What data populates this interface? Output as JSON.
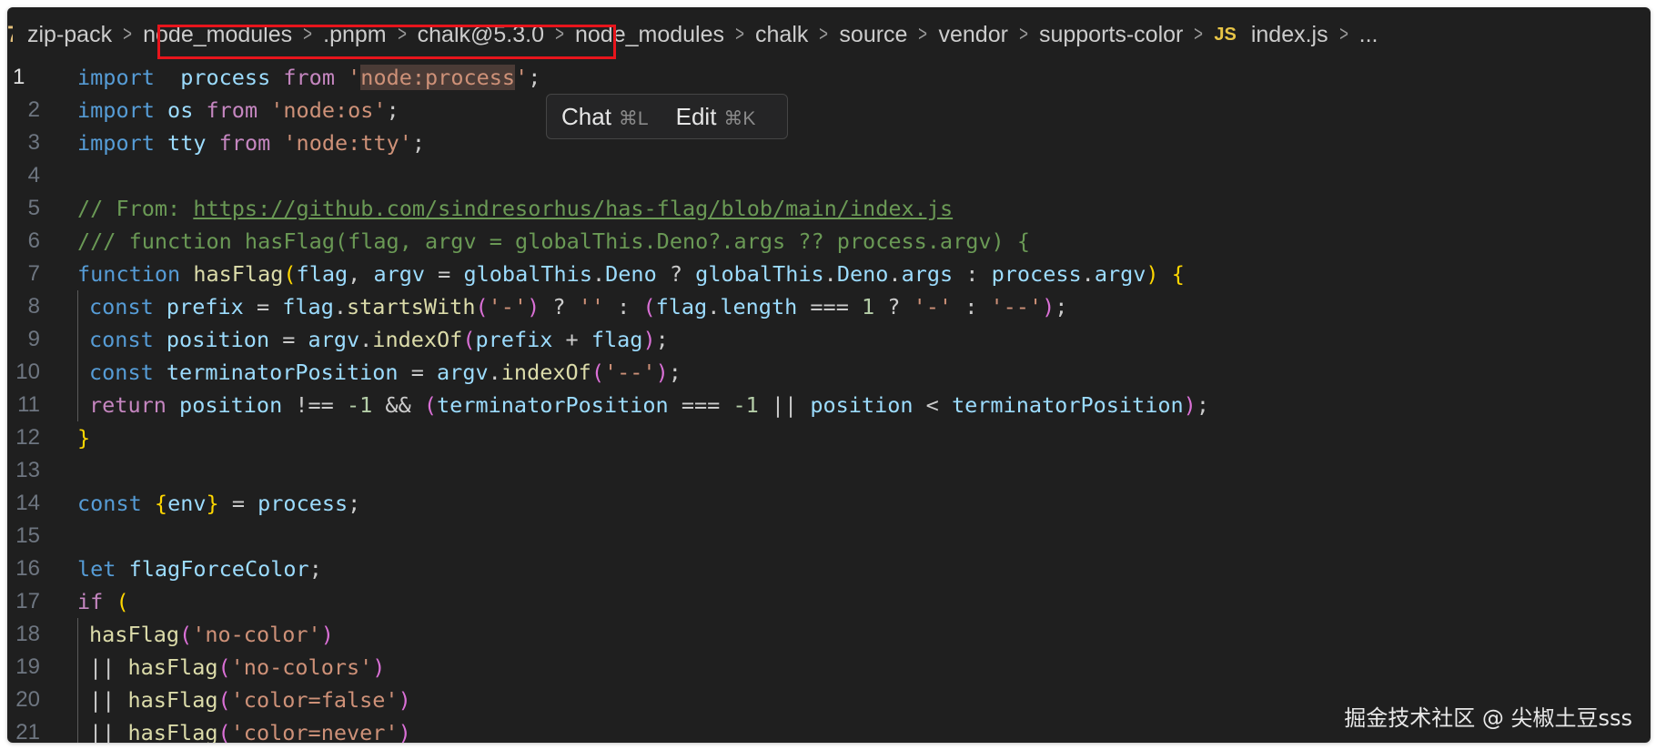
{
  "breadcrumb": {
    "items": [
      "zip-pack",
      "node_modules",
      ".pnpm",
      "chalk@5.3.0",
      "node_modules",
      "chalk",
      "source",
      "vendor",
      "supports-color"
    ],
    "file_icon": "JS",
    "file": "index.js",
    "more": "..."
  },
  "popup": {
    "chat_label": "Chat",
    "chat_shortcut": "⌘L",
    "edit_label": "Edit",
    "edit_shortcut": "⌘K"
  },
  "watermark": "掘金技术社区 @ 尖椒土豆sss",
  "colors": {
    "editor_bg": "#1f1f1f",
    "highlight_box": "#e8151c",
    "keyword": "#569cd6",
    "control": "#c586c0",
    "string": "#ce9178",
    "comment": "#6a9955",
    "function": "#dcdcaa",
    "variable": "#9cdcfe"
  },
  "active_line": 1,
  "code_lines": [
    {
      "n": "1",
      "indent": false,
      "tokens": [
        [
          "kw",
          "import"
        ],
        [
          "",
          "  "
        ],
        [
          "var",
          "process"
        ],
        [
          "",
          " "
        ],
        [
          "ctl",
          "from"
        ],
        [
          "",
          " "
        ],
        [
          "str",
          "'"
        ],
        [
          "strsel",
          "node:process"
        ],
        [
          "str",
          "'"
        ],
        [
          "",
          ";"
        ]
      ]
    },
    {
      "n": "2",
      "indent": false,
      "tokens": [
        [
          "kw",
          "import"
        ],
        [
          "",
          " "
        ],
        [
          "var",
          "os"
        ],
        [
          "",
          " "
        ],
        [
          "ctl",
          "from"
        ],
        [
          "",
          " "
        ],
        [
          "str",
          "'node:os'"
        ],
        [
          "",
          ";"
        ]
      ]
    },
    {
      "n": "3",
      "indent": false,
      "tokens": [
        [
          "kw",
          "import"
        ],
        [
          "",
          " "
        ],
        [
          "var",
          "tty"
        ],
        [
          "",
          " "
        ],
        [
          "ctl",
          "from"
        ],
        [
          "",
          " "
        ],
        [
          "str",
          "'node:tty'"
        ],
        [
          "",
          ";"
        ]
      ]
    },
    {
      "n": "4",
      "indent": false,
      "tokens": []
    },
    {
      "n": "5",
      "indent": false,
      "tokens": [
        [
          "cmt",
          "// From: "
        ],
        [
          "link",
          "https://github.com/sindresorhus/has-flag/blob/main/index.js"
        ]
      ]
    },
    {
      "n": "6",
      "indent": false,
      "tokens": [
        [
          "cmt",
          "/// function hasFlag(flag, argv = globalThis.Deno?.args ?? process.argv) {"
        ]
      ]
    },
    {
      "n": "7",
      "indent": false,
      "tokens": [
        [
          "kw",
          "function"
        ],
        [
          "",
          " "
        ],
        [
          "fn",
          "hasFlag"
        ],
        [
          "br1",
          "("
        ],
        [
          "var",
          "flag"
        ],
        [
          "",
          ", "
        ],
        [
          "var",
          "argv"
        ],
        [
          "",
          " = "
        ],
        [
          "var",
          "globalThis"
        ],
        [
          "",
          "."
        ],
        [
          "var",
          "Deno"
        ],
        [
          "",
          " ? "
        ],
        [
          "var",
          "globalThis"
        ],
        [
          "",
          "."
        ],
        [
          "var",
          "Deno"
        ],
        [
          "",
          "."
        ],
        [
          "var",
          "args"
        ],
        [
          "",
          " : "
        ],
        [
          "var",
          "process"
        ],
        [
          "",
          "."
        ],
        [
          "var",
          "argv"
        ],
        [
          "br1",
          ")"
        ],
        [
          "",
          " "
        ],
        [
          "br1",
          "{"
        ]
      ]
    },
    {
      "n": "8",
      "indent": true,
      "tokens": [
        [
          "kw",
          "const"
        ],
        [
          "",
          " "
        ],
        [
          "var",
          "prefix"
        ],
        [
          "",
          " = "
        ],
        [
          "var",
          "flag"
        ],
        [
          "",
          "."
        ],
        [
          "fn",
          "startsWith"
        ],
        [
          "br2",
          "("
        ],
        [
          "str",
          "'-'"
        ],
        [
          "br2",
          ")"
        ],
        [
          "",
          " ? "
        ],
        [
          "str",
          "''"
        ],
        [
          "",
          " : "
        ],
        [
          "br2",
          "("
        ],
        [
          "var",
          "flag"
        ],
        [
          "",
          "."
        ],
        [
          "var",
          "length"
        ],
        [
          "",
          " === "
        ],
        [
          "num",
          "1"
        ],
        [
          "",
          " ? "
        ],
        [
          "str",
          "'-'"
        ],
        [
          "",
          " : "
        ],
        [
          "str",
          "'--'"
        ],
        [
          "br2",
          ")"
        ],
        [
          "",
          ";"
        ]
      ]
    },
    {
      "n": "9",
      "indent": true,
      "tokens": [
        [
          "kw",
          "const"
        ],
        [
          "",
          " "
        ],
        [
          "var",
          "position"
        ],
        [
          "",
          " = "
        ],
        [
          "var",
          "argv"
        ],
        [
          "",
          "."
        ],
        [
          "fn",
          "indexOf"
        ],
        [
          "br2",
          "("
        ],
        [
          "var",
          "prefix"
        ],
        [
          "",
          " + "
        ],
        [
          "var",
          "flag"
        ],
        [
          "br2",
          ")"
        ],
        [
          "",
          ";"
        ]
      ]
    },
    {
      "n": "10",
      "indent": true,
      "tokens": [
        [
          "kw",
          "const"
        ],
        [
          "",
          " "
        ],
        [
          "var",
          "terminatorPosition"
        ],
        [
          "",
          " = "
        ],
        [
          "var",
          "argv"
        ],
        [
          "",
          "."
        ],
        [
          "fn",
          "indexOf"
        ],
        [
          "br2",
          "("
        ],
        [
          "str",
          "'--'"
        ],
        [
          "br2",
          ")"
        ],
        [
          "",
          ";"
        ]
      ]
    },
    {
      "n": "11",
      "indent": true,
      "tokens": [
        [
          "ctl",
          "return"
        ],
        [
          "",
          " "
        ],
        [
          "var",
          "position"
        ],
        [
          "",
          " !== "
        ],
        [
          "num",
          "-1"
        ],
        [
          "",
          " && "
        ],
        [
          "br2",
          "("
        ],
        [
          "var",
          "terminatorPosition"
        ],
        [
          "",
          " === "
        ],
        [
          "num",
          "-1"
        ],
        [
          "",
          " || "
        ],
        [
          "var",
          "position"
        ],
        [
          "",
          " < "
        ],
        [
          "var",
          "terminatorPosition"
        ],
        [
          "br2",
          ")"
        ],
        [
          "",
          ";"
        ]
      ]
    },
    {
      "n": "12",
      "indent": false,
      "tokens": [
        [
          "br1",
          "}"
        ]
      ]
    },
    {
      "n": "13",
      "indent": false,
      "tokens": []
    },
    {
      "n": "14",
      "indent": false,
      "tokens": [
        [
          "kw",
          "const"
        ],
        [
          "",
          " "
        ],
        [
          "br1",
          "{"
        ],
        [
          "var",
          "env"
        ],
        [
          "br1",
          "}"
        ],
        [
          "",
          " = "
        ],
        [
          "var",
          "process"
        ],
        [
          "",
          ";"
        ]
      ]
    },
    {
      "n": "15",
      "indent": false,
      "tokens": []
    },
    {
      "n": "16",
      "indent": false,
      "tokens": [
        [
          "kw",
          "let"
        ],
        [
          "",
          " "
        ],
        [
          "var",
          "flagForceColor"
        ],
        [
          "",
          ";"
        ]
      ]
    },
    {
      "n": "17",
      "indent": false,
      "tokens": [
        [
          "ctl",
          "if"
        ],
        [
          "",
          " "
        ],
        [
          "br1",
          "("
        ]
      ]
    },
    {
      "n": "18",
      "indent": true,
      "tokens": [
        [
          "fn",
          "hasFlag"
        ],
        [
          "br2",
          "("
        ],
        [
          "str",
          "'no-color'"
        ],
        [
          "br2",
          ")"
        ]
      ]
    },
    {
      "n": "19",
      "indent": true,
      "tokens": [
        [
          "",
          "|| "
        ],
        [
          "fn",
          "hasFlag"
        ],
        [
          "br2",
          "("
        ],
        [
          "str",
          "'no-colors'"
        ],
        [
          "br2",
          ")"
        ]
      ]
    },
    {
      "n": "20",
      "indent": true,
      "tokens": [
        [
          "",
          "|| "
        ],
        [
          "fn",
          "hasFlag"
        ],
        [
          "br2",
          "("
        ],
        [
          "str",
          "'color=false'"
        ],
        [
          "br2",
          ")"
        ]
      ]
    },
    {
      "n": "21",
      "indent": true,
      "tokens": [
        [
          "",
          "|| "
        ],
        [
          "fn",
          "hasFlag"
        ],
        [
          "br2",
          "("
        ],
        [
          "str",
          "'color=never'"
        ],
        [
          "br2",
          ")"
        ]
      ]
    }
  ]
}
